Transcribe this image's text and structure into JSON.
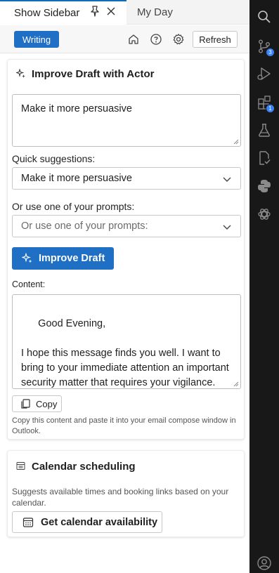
{
  "tabs": [
    {
      "label": "Show Sidebar"
    },
    {
      "label": "My Day"
    }
  ],
  "toolbar": {
    "mode_label": "Writing",
    "refresh_label": "Refresh"
  },
  "improve_card": {
    "title": "Improve Draft with Actor",
    "instruction_value": "Make it more persuasive",
    "quick_label": "Quick suggestions:",
    "quick_value": "Make it more persuasive",
    "prompts_label": "Or use one of your prompts:",
    "prompts_placeholder": "Or use one of your prompts:",
    "improve_button": "Improve Draft",
    "content_label": "Content:",
    "content_text": "Good Evening,\n\nI hope this message finds you well. I want to bring to your immediate attention an important security matter that requires your vigilance. Earlier today, an email was maintained sent from me Sunday Manage it",
    "copy_button": "Copy",
    "copy_hint": "Copy this content and paste it into your email compose window in Outlook."
  },
  "calendar_card": {
    "title": "Calendar scheduling",
    "description": "Suggests available times and booking links based on your calendar.",
    "button": "Get calendar availability"
  },
  "activity_bar": {
    "icons": [
      "search-icon",
      "source-control-icon",
      "run-debug-icon",
      "extensions-icon",
      "testing-icon",
      "file-check-icon",
      "python-icon",
      "openai-icon",
      "account-icon"
    ],
    "source_control_badge": "3",
    "extensions_badge": "1"
  },
  "colors": {
    "accent": "#1f6fc5",
    "rail": "#181818"
  }
}
